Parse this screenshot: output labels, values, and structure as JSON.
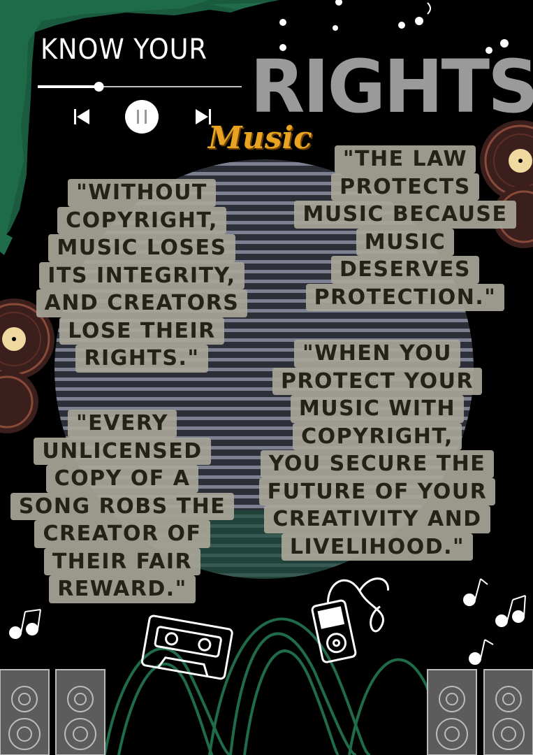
{
  "header": {
    "title_small": "KNOW YOUR",
    "title_big": "RIGHTS",
    "subtitle": "Music"
  },
  "player": {
    "progress": 0.3,
    "icons": [
      "previous-icon",
      "pause-icon",
      "next-icon"
    ]
  },
  "quotes": [
    {
      "lines": [
        "\"WITHOUT",
        "COPYRIGHT,",
        "MUSIC LOSES",
        "ITS INTEGRITY,",
        "AND CREATORS",
        "LOSE THEIR",
        "RIGHTS.\""
      ]
    },
    {
      "lines": [
        "\"THE LAW",
        "PROTECTS",
        "MUSIC BECAUSE",
        "MUSIC",
        "DESERVES",
        "PROTECTION.\""
      ]
    },
    {
      "lines": [
        "\"EVERY",
        "UNLICENSED",
        "COPY OF A",
        "SONG ROBS THE",
        "CREATOR OF",
        "THEIR FAIR",
        "REWARD.\""
      ]
    },
    {
      "lines": [
        "\"WHEN YOU",
        "PROTECT YOUR",
        "MUSIC WITH",
        "COPYRIGHT,",
        "YOU SECURE THE",
        "FUTURE OF YOUR",
        "CREATIVITY AND",
        "LIVELIHOOD.\""
      ]
    }
  ],
  "colors": {
    "background": "#000000",
    "accent_green": "#1f6b4a",
    "title_gray": "#9a9a9a",
    "music_gold": "#e8a323",
    "quote_box": "#a8a598",
    "quote_text": "#242118"
  }
}
